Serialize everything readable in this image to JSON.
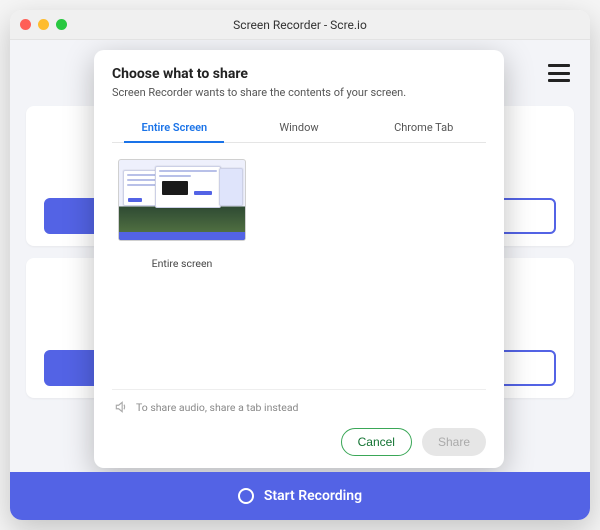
{
  "window": {
    "title": "Screen Recorder - Scre.io"
  },
  "footer": {
    "start_label": "Start Recording"
  },
  "modal": {
    "title": "Choose what to share",
    "subtitle": "Screen Recorder wants to share the contents of your screen.",
    "tabs": {
      "entire": "Entire Screen",
      "window": "Window",
      "chrome": "Chrome Tab"
    },
    "thumb_label": "Entire screen",
    "hint": "To share audio, share a tab instead",
    "cancel": "Cancel",
    "share": "Share"
  }
}
